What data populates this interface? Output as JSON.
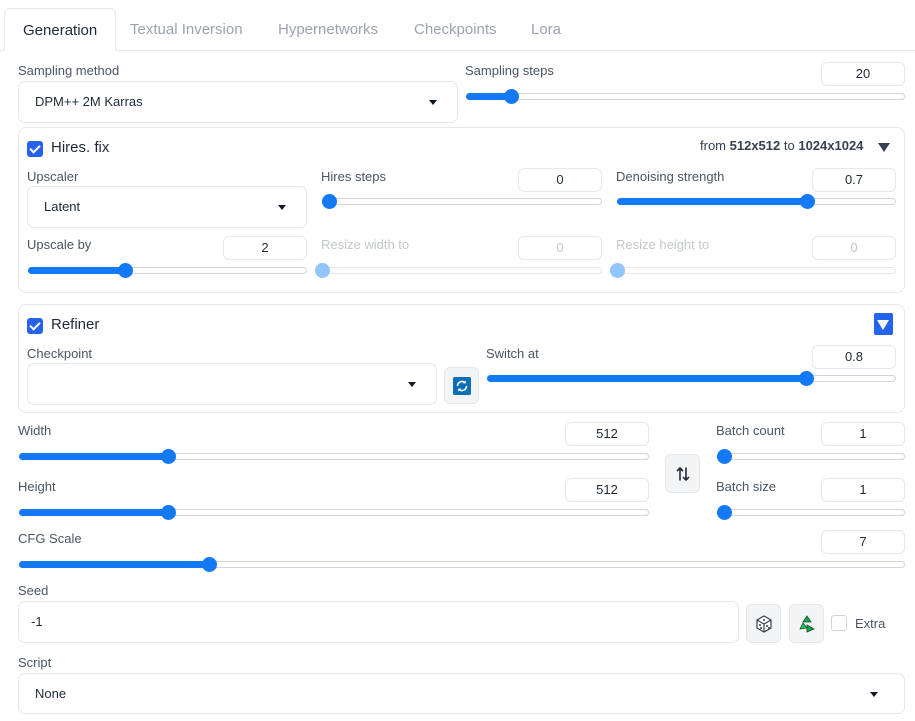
{
  "tabs": [
    "Generation",
    "Textual Inversion",
    "Hypernetworks",
    "Checkpoints",
    "Lora"
  ],
  "sampling": {
    "method_label": "Sampling method",
    "method_value": "DPM++ 2M Karras",
    "steps_label": "Sampling steps",
    "steps_value": "20",
    "steps_fraction": 0.09
  },
  "hires": {
    "title": "Hires. fix",
    "checked": true,
    "summary_from": "from",
    "summary_from_value": "512x512",
    "summary_to": "to",
    "summary_to_value": "1024x1024",
    "upscaler_label": "Upscaler",
    "upscaler_value": "Latent",
    "steps_label": "Hires steps",
    "steps_value": "0",
    "steps_fraction": 0.0,
    "denoise_label": "Denoising strength",
    "denoise_value": "0.7",
    "denoise_fraction": 0.69,
    "upscale_label": "Upscale by",
    "upscale_value": "2",
    "upscale_fraction": 0.34,
    "resize_w_label": "Resize width to",
    "resize_w_value": "0",
    "resize_h_label": "Resize height to",
    "resize_h_value": "0"
  },
  "refiner": {
    "title": "Refiner",
    "checked": true,
    "checkpoint_label": "Checkpoint",
    "checkpoint_value": "",
    "switch_label": "Switch at",
    "switch_value": "0.8",
    "switch_fraction": 0.79
  },
  "size": {
    "width_label": "Width",
    "width_value": "512",
    "width_fraction": 0.23,
    "height_label": "Height",
    "height_value": "512",
    "height_fraction": 0.23
  },
  "batch": {
    "count_label": "Batch count",
    "count_value": "1",
    "count_fraction": 0.0,
    "size_label": "Batch size",
    "size_value": "1",
    "size_fraction": 0.0
  },
  "cfg": {
    "label": "CFG Scale",
    "value": "7",
    "fraction": 0.21
  },
  "seed": {
    "label": "Seed",
    "value": "-1",
    "extra_label": "Extra",
    "extra_checked": false
  },
  "script": {
    "label": "Script",
    "value": "None"
  },
  "colors": {
    "accent": "#1479f5",
    "checkbox": "#2563eb"
  }
}
